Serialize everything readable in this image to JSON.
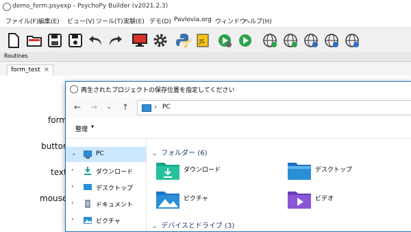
{
  "window": {
    "title": "demo_form.psyexp - PsychoPy Builder (v2021.2.3)"
  },
  "menu": [
    "ファイル(F)",
    "編集(E)",
    "ビュー(V)",
    "ツール(T)",
    "実験(E)",
    "デモ(D)",
    "Pavlovia.org",
    "ウィンドウ",
    "ヘルプ(H)"
  ],
  "routines": {
    "label": "Routines"
  },
  "tab": {
    "label": "form_test",
    "close": "×"
  },
  "components": [
    "form",
    "button",
    "text",
    "mouse"
  ],
  "dialog": {
    "title": "再生されたプロジェクトの保存位置を指定してください",
    "address": "PC",
    "organize": "整理",
    "nav_items": [
      {
        "label": "PC",
        "selected": true
      },
      {
        "label": "ダウンロード"
      },
      {
        "label": "デスクトップ"
      },
      {
        "label": "ドキュメント"
      },
      {
        "label": "ピクチャ"
      }
    ],
    "groups": {
      "folders": "フォルダー (6)",
      "devices": "デバイスとドライブ (3)"
    },
    "folders": [
      {
        "label": "ダウンロード",
        "icon": "download-folder-icon"
      },
      {
        "label": "デスクトップ",
        "icon": "desktop-folder-icon"
      },
      {
        "label": "ピクチャ",
        "icon": "pictures-folder-icon"
      },
      {
        "label": "ビデオ",
        "icon": "videos-folder-icon"
      }
    ]
  },
  "colors": {
    "accent": "#1e6fbf",
    "selection": "#cce8ff",
    "folder_teal": "#1aa58a",
    "folder_blue": "#2b8fd8"
  }
}
